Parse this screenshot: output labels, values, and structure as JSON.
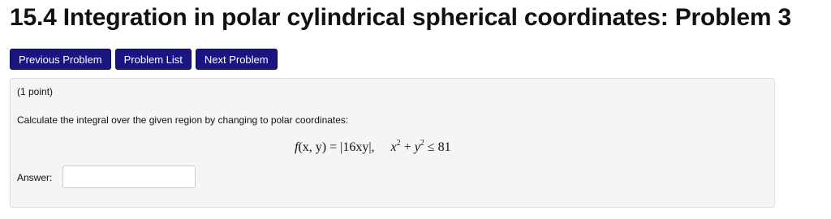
{
  "page_title": "15.4 Integration in polar cylindrical spherical coordinates: Problem 3",
  "nav": {
    "previous_label": "Previous Problem",
    "list_label": "Problem List",
    "next_label": "Next Problem"
  },
  "problem": {
    "points": "(1 point)",
    "prompt": "Calculate the integral over the given region by changing to polar coordinates:",
    "formula": {
      "func": "f",
      "args": "(x, y)",
      "equals": "=",
      "expr": "|16xy|,",
      "region_x": "x",
      "exp_x": "2",
      "plus": "+",
      "region_y": "y",
      "exp_y": "2",
      "leq": "≤",
      "bound": "81"
    },
    "answer_label": "Answer:",
    "answer_value": ""
  },
  "colors": {
    "button_bg": "#1a1580",
    "panel_bg": "#f5f5f5"
  }
}
